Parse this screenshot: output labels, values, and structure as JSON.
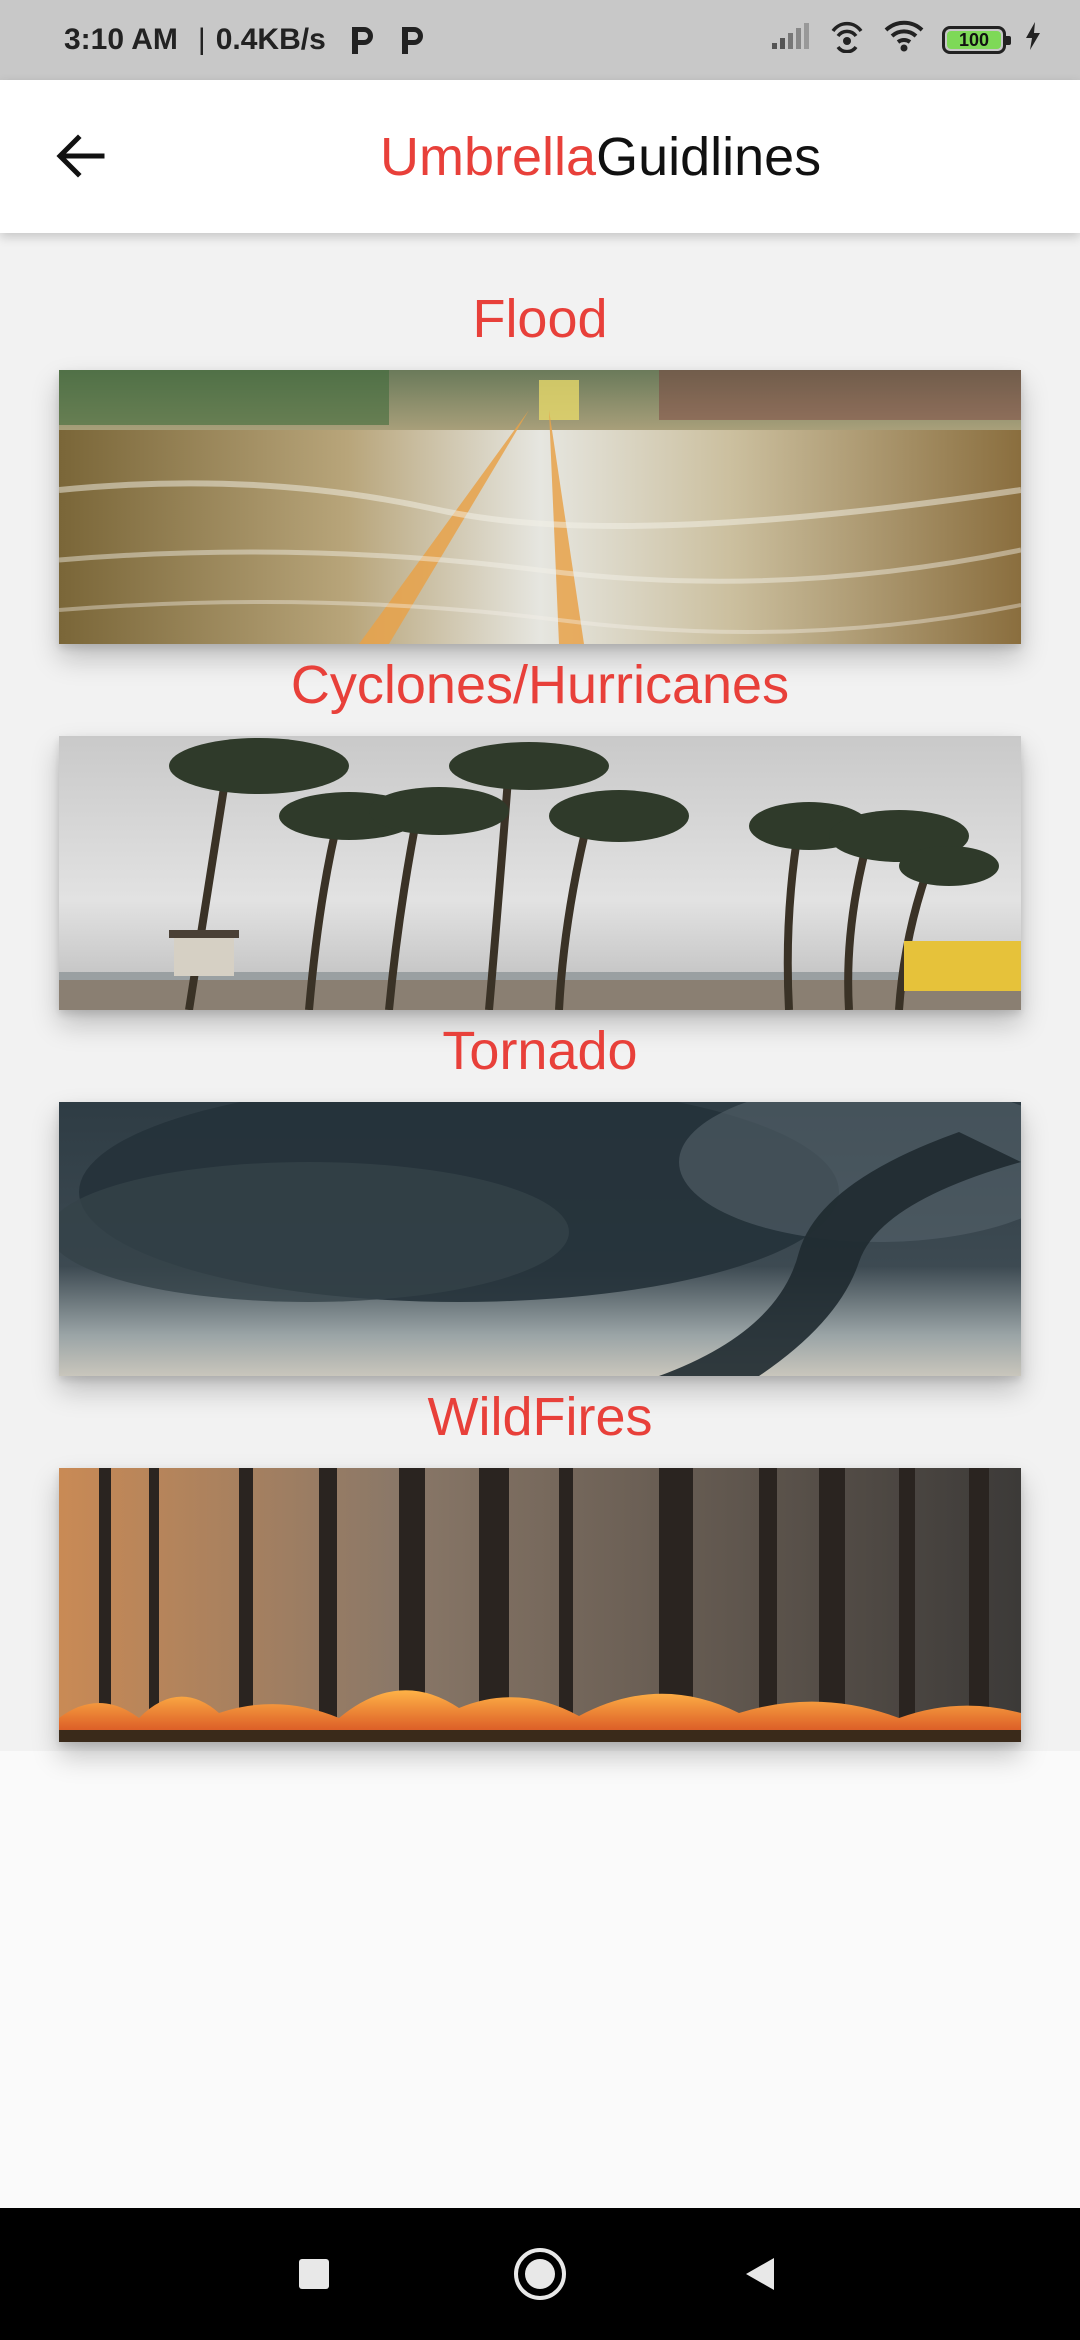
{
  "status_bar": {
    "time": "3:10 AM",
    "separator": "|",
    "speed": "0.4KB/s",
    "battery_level": "100",
    "battery_color": "#7ed957"
  },
  "app_bar": {
    "title_part1": "Umbrella",
    "title_part2": "Guidlines",
    "title_accent_color": "#e8403a",
    "back_icon": "arrow-left-icon"
  },
  "disasters": [
    {
      "label": "Flood",
      "image": "flooded-road-photo"
    },
    {
      "label": "Cyclones/Hurricanes",
      "image": "palm-trees-storm-photo"
    },
    {
      "label": "Tornado",
      "image": "tornado-clouds-photo"
    },
    {
      "label": "WildFires",
      "image": "forest-fire-photo"
    }
  ],
  "nav_bar": {
    "recents_icon": "square-icon",
    "home_icon": "circle-icon",
    "back_icon": "triangle-back-icon"
  }
}
